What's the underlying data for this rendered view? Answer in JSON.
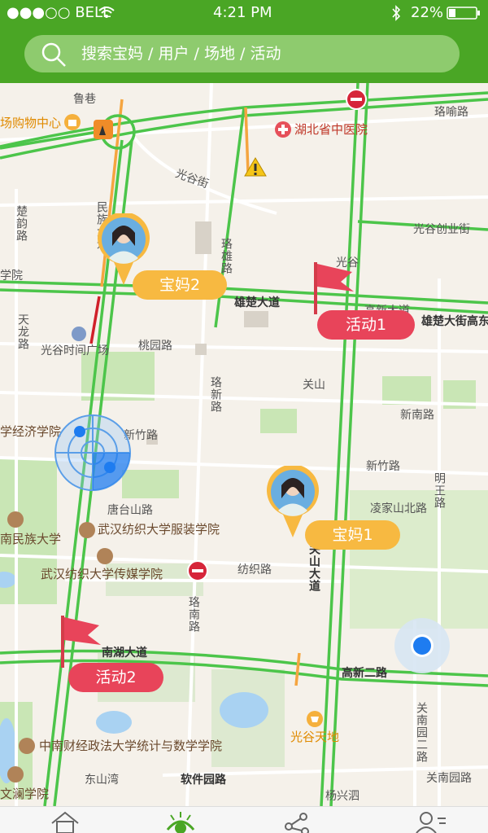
{
  "status_bar": {
    "carrier": "●●●○○ BELL",
    "time": "4:21 PM",
    "battery": "22%",
    "icons": [
      "wifi-icon",
      "bluetooth-icon",
      "battery-icon"
    ]
  },
  "search": {
    "placeholder": "搜索宝妈 / 用户 / 场地 / 活动",
    "icon": "search-icon"
  },
  "map": {
    "labels": {
      "luxiang": "鲁巷",
      "shopping": "场购物中心",
      "hospital": "湖北省中医院",
      "luoyu": "珞喻路",
      "guanggu_st": "光谷街",
      "chuyun": "楚韵路",
      "minzu_top": "民族大道",
      "guanggu_cy": "光谷创业街",
      "xuexiao": "学院",
      "luoxiong": "珞雄路",
      "guanggu": "光谷",
      "xiongchu": "雄楚大道",
      "gaoxin": "高新大道",
      "xiongchu2": "雄楚大街高东",
      "tianlong": "天龙路",
      "timesq": "光谷时间广场",
      "taoyuan": "桃园路",
      "guanshan": "关山",
      "luoxin": "珞新路",
      "xinnan": "新南路",
      "econ": "学经济学院",
      "xinzhu": "新竹路",
      "xinzhu2": "新竹路",
      "tangshan": "唐台山路",
      "textile": "武汉纺织大学服装学院",
      "lingjia": "凌家山北路",
      "mingwang": "明王路",
      "minzu_u": "南民族大学",
      "media": "武汉纺织大学传媒学院",
      "fangzhi": "纺织路",
      "luonan": "珞南路",
      "guanshan_ave": "关山大道",
      "nanhu": "南湖大道",
      "gaoxin2": "高新二路",
      "guanggu_tiandi": "光谷天地",
      "stat_school": "中南财经政法大学统计与数学学院",
      "guannan2": "关南园二路",
      "dongshanwan": "东山湾",
      "software": "软件园路",
      "guannan": "关南园路",
      "yangxing": "杨兴泗",
      "lanxue": "文澜学院"
    },
    "markers": {
      "mom2": "宝妈2",
      "mom1": "宝妈1",
      "act1": "活动1",
      "act2": "活动2"
    }
  },
  "tab_bar": {
    "tabs": [
      "home-icon",
      "eye-icon",
      "share-icon",
      "profile-icon"
    ]
  },
  "colors": {
    "green": "#4aa625",
    "road_green": "#4cc54a",
    "mom_pill": "#f7b941",
    "act_pill": "#e8445a",
    "location_blue": "#1e7cf0"
  }
}
